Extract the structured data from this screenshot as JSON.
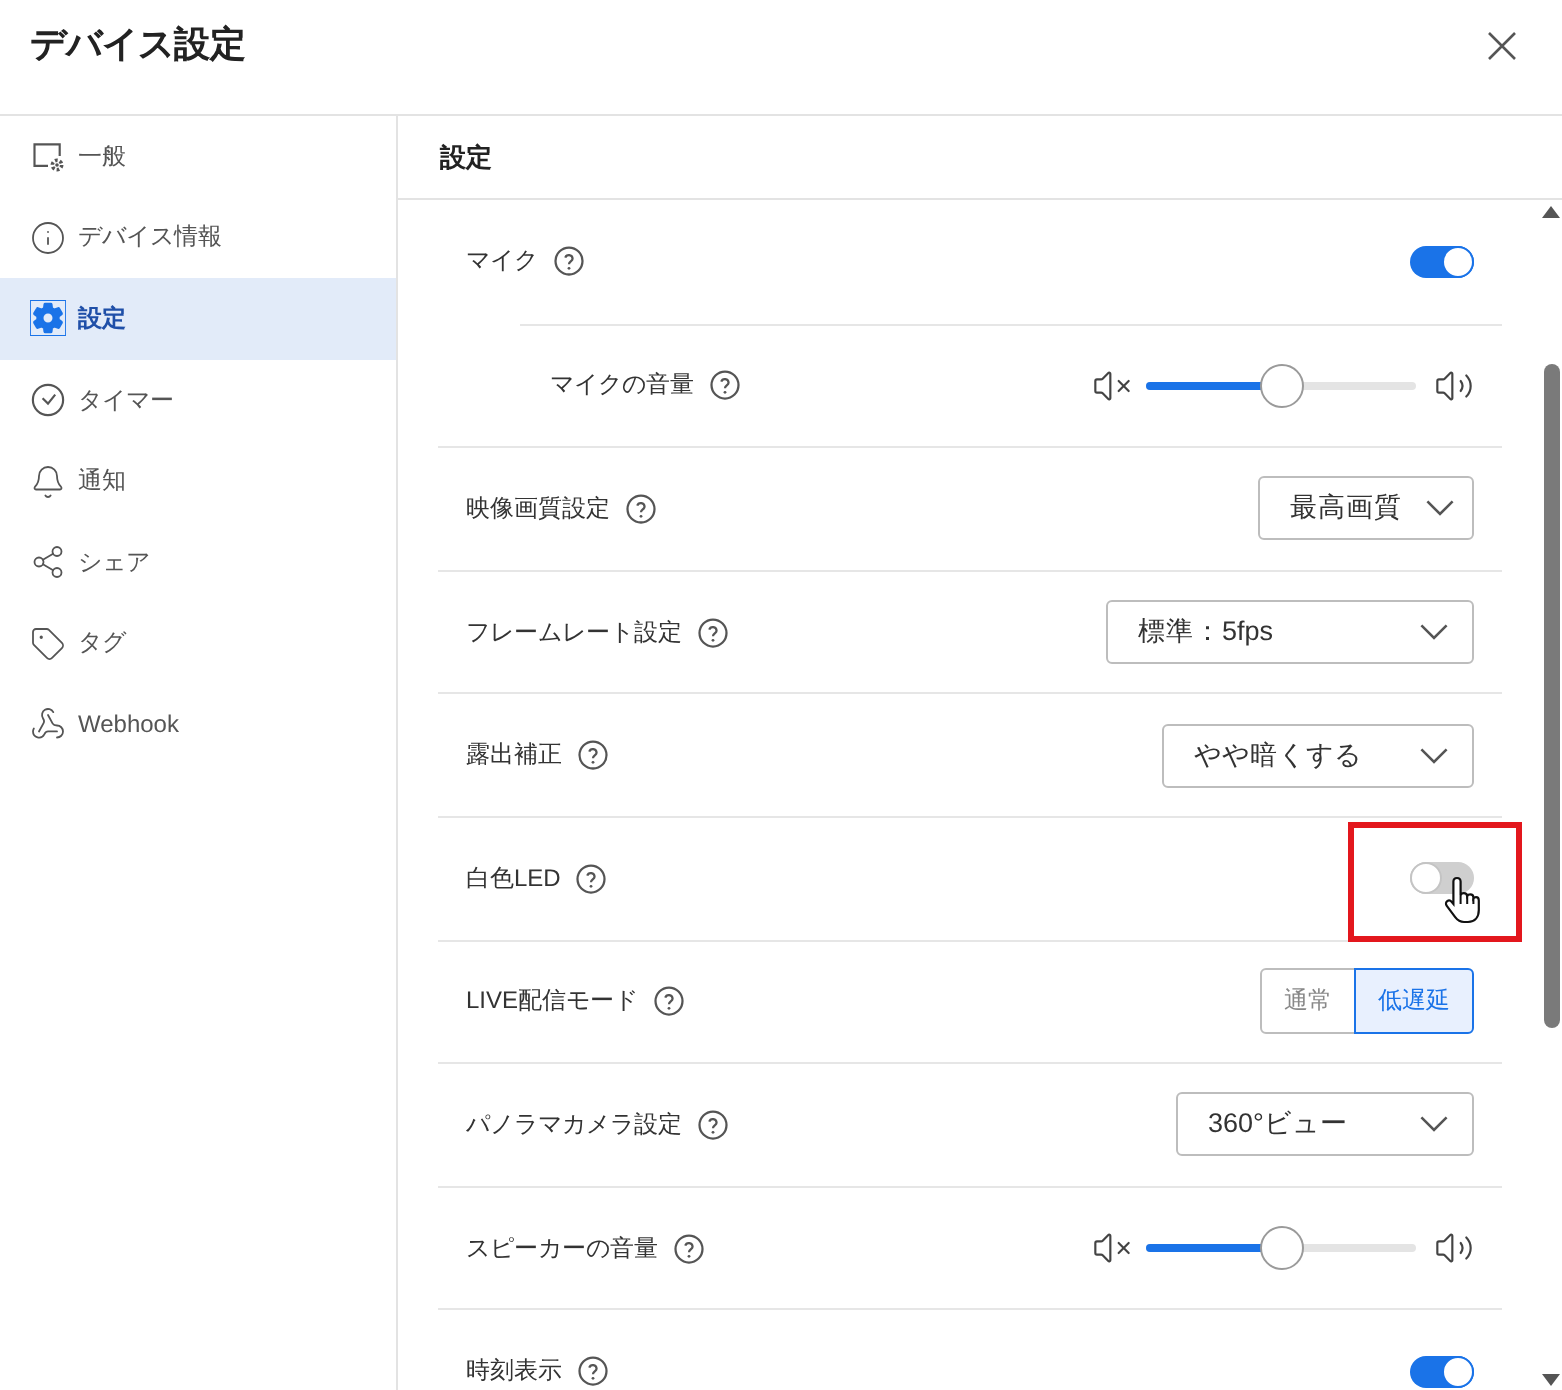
{
  "dialog": {
    "title": "デバイス設定"
  },
  "sidebar": {
    "items": [
      {
        "label": "一般",
        "selected": false
      },
      {
        "label": "デバイス情報",
        "selected": false
      },
      {
        "label": "設定",
        "selected": true
      },
      {
        "label": "タイマー",
        "selected": false
      },
      {
        "label": "通知",
        "selected": false
      },
      {
        "label": "シェア",
        "selected": false
      },
      {
        "label": "タグ",
        "selected": false
      },
      {
        "label": "Webhook",
        "selected": false
      }
    ]
  },
  "panel": {
    "title": "設定",
    "settings": [
      {
        "kind": "toggle",
        "label": "マイク",
        "on": true,
        "children": [
          {
            "kind": "slider",
            "label": "マイクの音量",
            "level": 0.5
          }
        ]
      },
      {
        "kind": "select",
        "label": "映像画質設定",
        "value": "最高画質"
      },
      {
        "kind": "select",
        "label": "フレームレート設定",
        "value": "標準：5fps"
      },
      {
        "kind": "select",
        "label": "露出補正",
        "value": "やや暗くする"
      },
      {
        "kind": "toggle",
        "label": "白色LED",
        "on": false,
        "highlighted": true,
        "cursor_over": true
      },
      {
        "kind": "segmented",
        "label": "LIVE配信モード",
        "options": [
          {
            "label": "通常",
            "selected": false
          },
          {
            "label": "低遅延",
            "selected": true
          }
        ]
      },
      {
        "kind": "select",
        "label": "パノラマカメラ設定",
        "value": "360°ビュー"
      },
      {
        "kind": "slider",
        "label": "スピーカーの音量",
        "level": 0.5
      },
      {
        "kind": "toggle",
        "label": "時刻表示",
        "on": true
      }
    ]
  }
}
